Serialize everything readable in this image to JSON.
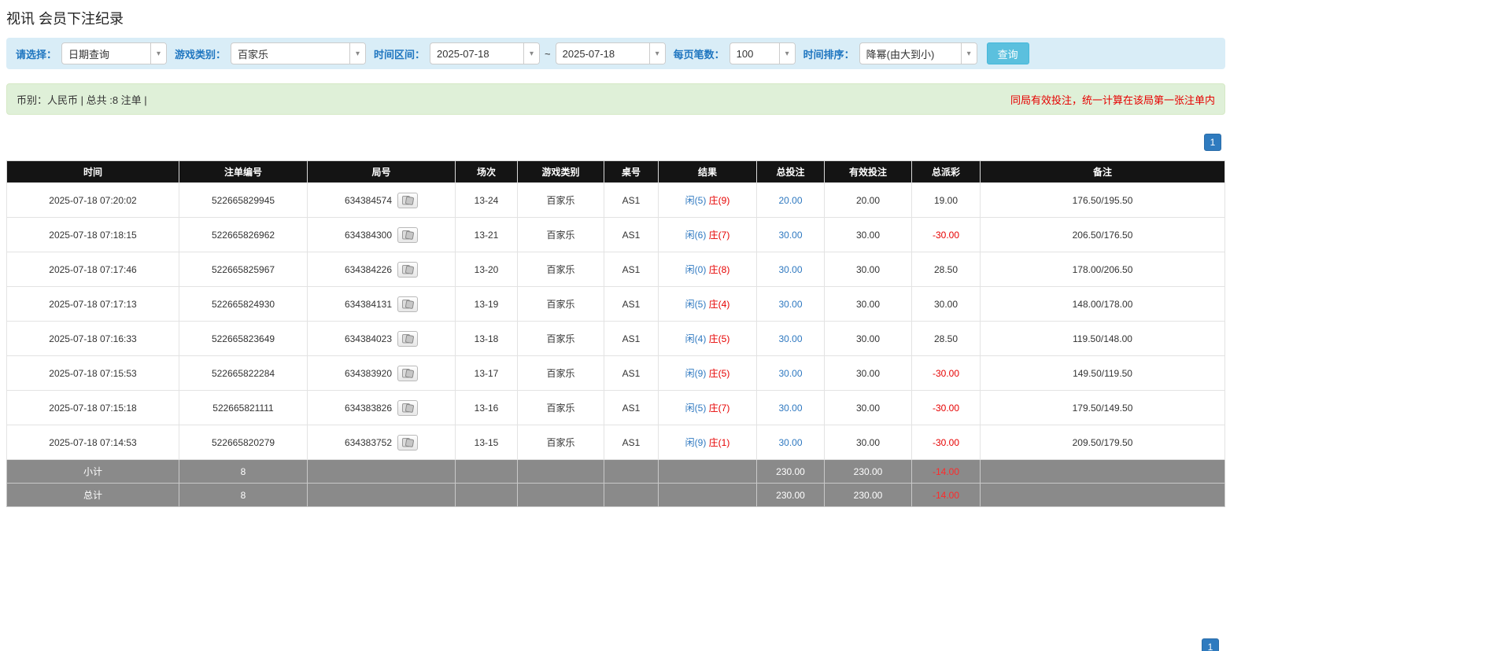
{
  "page": {
    "title": "视讯 会员下注纪录"
  },
  "filters": {
    "select_label": "请选择：",
    "select_value": "日期查询",
    "game_type_label": "游戏类别：",
    "game_type_value": "百家乐",
    "time_range_label": "时间区间：",
    "date_from": "2025-07-18",
    "date_separator": "~",
    "date_to": "2025-07-18",
    "page_size_label": "每页笔数：",
    "page_size_value": "100",
    "sort_label": "时间排序：",
    "sort_value": "降幂(由大到小)",
    "search_button": "查询",
    "dropdown_icon": "▾"
  },
  "summary": {
    "left": "币别：人民币 | 总共 :8 注单 |",
    "right": "同局有效投注，统一计算在该局第一张注单内"
  },
  "pagination": {
    "page": "1"
  },
  "table": {
    "headers": [
      "时间",
      "注单编号",
      "局号",
      "场次",
      "游戏类别",
      "桌号",
      "结果",
      "总投注",
      "有效投注",
      "总派彩",
      "备注"
    ],
    "rows": [
      {
        "time": "2025-07-18 07:20:02",
        "bet_id": "522665829945",
        "round_id": "634384574",
        "session": "13-24",
        "game": "百家乐",
        "table": "AS1",
        "player": "闲(5)",
        "banker": "庄(9)",
        "total_bet": "20.00",
        "valid_bet": "20.00",
        "payout": "19.00",
        "remark": "176.50/195.50"
      },
      {
        "time": "2025-07-18 07:18:15",
        "bet_id": "522665826962",
        "round_id": "634384300",
        "session": "13-21",
        "game": "百家乐",
        "table": "AS1",
        "player": "闲(6)",
        "banker": "庄(7)",
        "total_bet": "30.00",
        "valid_bet": "30.00",
        "payout": "-30.00",
        "remark": "206.50/176.50"
      },
      {
        "time": "2025-07-18 07:17:46",
        "bet_id": "522665825967",
        "round_id": "634384226",
        "session": "13-20",
        "game": "百家乐",
        "table": "AS1",
        "player": "闲(0)",
        "banker": "庄(8)",
        "total_bet": "30.00",
        "valid_bet": "30.00",
        "payout": "28.50",
        "remark": "178.00/206.50"
      },
      {
        "time": "2025-07-18 07:17:13",
        "bet_id": "522665824930",
        "round_id": "634384131",
        "session": "13-19",
        "game": "百家乐",
        "table": "AS1",
        "player": "闲(5)",
        "banker": "庄(4)",
        "total_bet": "30.00",
        "valid_bet": "30.00",
        "payout": "30.00",
        "remark": "148.00/178.00"
      },
      {
        "time": "2025-07-18 07:16:33",
        "bet_id": "522665823649",
        "round_id": "634384023",
        "session": "13-18",
        "game": "百家乐",
        "table": "AS1",
        "player": "闲(4)",
        "banker": "庄(5)",
        "total_bet": "30.00",
        "valid_bet": "30.00",
        "payout": "28.50",
        "remark": "119.50/148.00"
      },
      {
        "time": "2025-07-18 07:15:53",
        "bet_id": "522665822284",
        "round_id": "634383920",
        "session": "13-17",
        "game": "百家乐",
        "table": "AS1",
        "player": "闲(9)",
        "banker": "庄(5)",
        "total_bet": "30.00",
        "valid_bet": "30.00",
        "payout": "-30.00",
        "remark": "149.50/119.50"
      },
      {
        "time": "2025-07-18 07:15:18",
        "bet_id": "522665821111",
        "round_id": "634383826",
        "session": "13-16",
        "game": "百家乐",
        "table": "AS1",
        "player": "闲(5)",
        "banker": "庄(7)",
        "total_bet": "30.00",
        "valid_bet": "30.00",
        "payout": "-30.00",
        "remark": "179.50/149.50"
      },
      {
        "time": "2025-07-18 07:14:53",
        "bet_id": "522665820279",
        "round_id": "634383752",
        "session": "13-15",
        "game": "百家乐",
        "table": "AS1",
        "player": "闲(9)",
        "banker": "庄(1)",
        "total_bet": "30.00",
        "valid_bet": "30.00",
        "payout": "-30.00",
        "remark": "209.50/179.50"
      }
    ],
    "subtotal": {
      "label": "小计",
      "count": "8",
      "total_bet": "230.00",
      "valid_bet": "230.00",
      "payout": "-14.00",
      "remark": ""
    },
    "total": {
      "label": "总计",
      "count": "8",
      "total_bet": "230.00",
      "valid_bet": "230.00",
      "payout": "-14.00",
      "remark": ""
    }
  }
}
